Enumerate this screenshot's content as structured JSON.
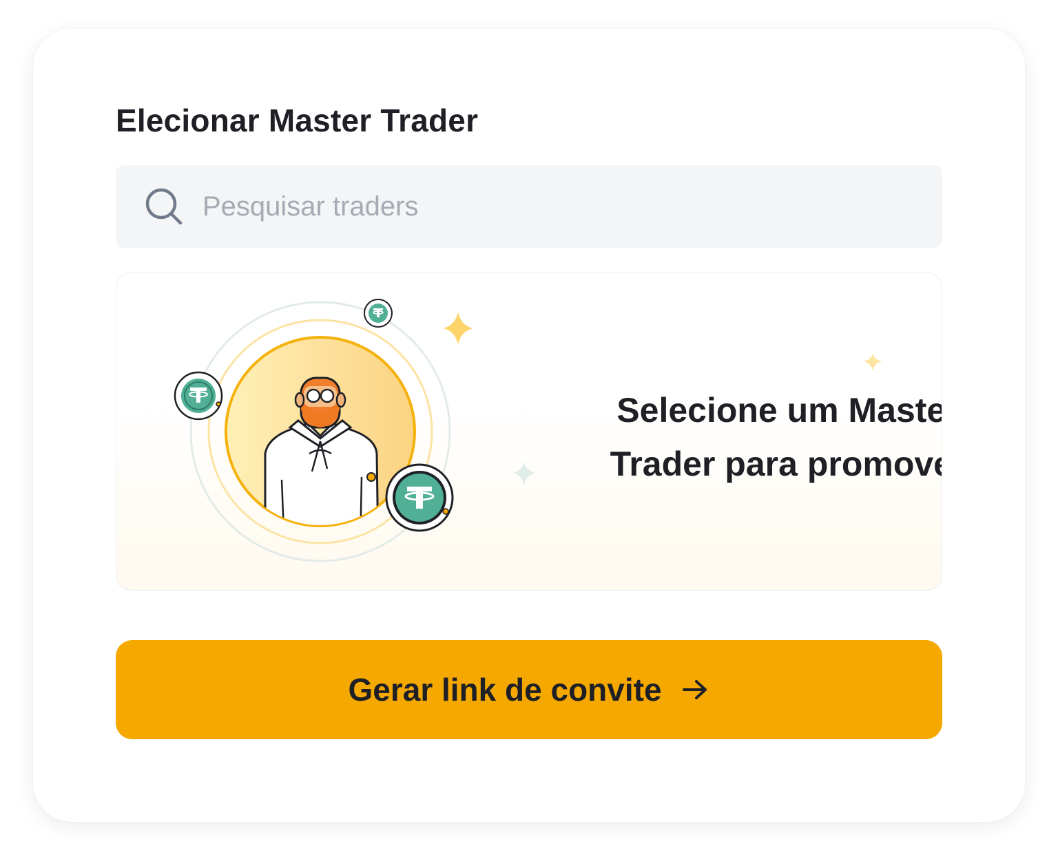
{
  "header": {
    "title": "Elecionar Master Trader"
  },
  "search": {
    "placeholder": "Pesquisar traders",
    "value": "",
    "icon": "search-icon"
  },
  "empty_state": {
    "message": "Selecione um Master\nTrader para promover",
    "illustration": "trader-avatar-with-usdt-coins"
  },
  "cta": {
    "label": "Gerar link de convite",
    "icon": "arrow-right-icon"
  },
  "colors": {
    "accent": "#f5a800",
    "text": "#1e2026",
    "placeholder": "#a5aab3",
    "search_bg": "#f4f5f7",
    "coin_green": "#50af95"
  }
}
